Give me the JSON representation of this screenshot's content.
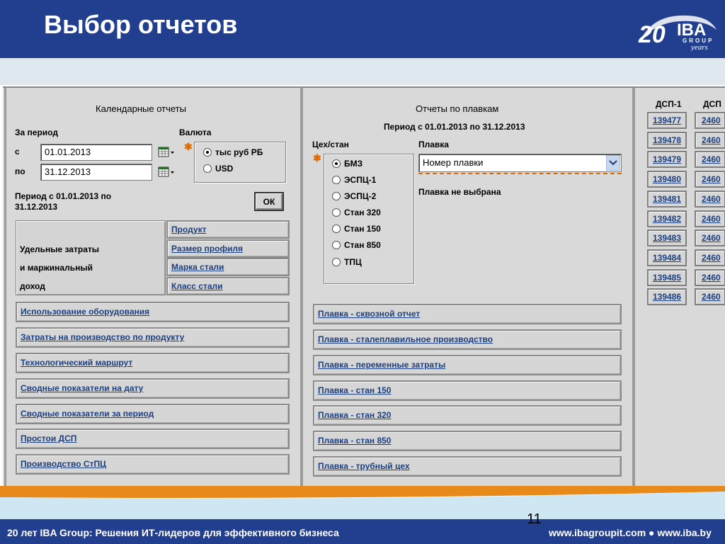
{
  "slide": {
    "title": "Выбор отчетов",
    "page_number": "11",
    "footer_left": "20 лет IBA Group: Решения ИТ-лидеров для эффективного бизнеса",
    "footer_right": "www.ibagroupit.com ● www.iba.by"
  },
  "logo": {
    "main": "IBA",
    "group": "GROUP",
    "years": "years",
    "number": "20"
  },
  "calendar": {
    "header": "Календарные отчеты",
    "period_label": "За период",
    "from_label": "с",
    "to_label": "по",
    "from_value": "01.01.2013",
    "to_value": "31.12.2013",
    "currency_label": "Валюта",
    "currency_options": [
      {
        "label": "тыс руб РБ",
        "selected": true
      },
      {
        "label": "USD",
        "selected": false
      }
    ],
    "period_text": "Период с 01.01.2013 по 31.12.2013",
    "period_text_line1": "Период с 01.01.2013 по",
    "period_text_line2": "31.12.2013",
    "ok_label": "ОК",
    "group_label_lines": [
      "Удельные затраты",
      "и маржинальный",
      "доход"
    ],
    "group_links": [
      "Продукт",
      "Размер профиля",
      "Марка стали",
      "Класс стали"
    ],
    "links": [
      "Использование оборудования",
      "Затраты на производство по продукту",
      "Технологический маршрут",
      "Сводные показатели на дату",
      "Сводные показатели за период",
      "Простои ДСП",
      "Производство СтПЦ"
    ]
  },
  "melts": {
    "header": "Отчеты по плавкам",
    "period_text": "Период с 01.01.2013 по 31.12.2013",
    "shop_label": "Цех/стан",
    "shops": [
      {
        "label": "БМЗ",
        "selected": true
      },
      {
        "label": "ЭСПЦ-1",
        "selected": false
      },
      {
        "label": "ЭСПЦ-2",
        "selected": false
      },
      {
        "label": "Стан 320",
        "selected": false
      },
      {
        "label": "Стан 150",
        "selected": false
      },
      {
        "label": "Стан 850",
        "selected": false
      },
      {
        "label": "ТПЦ",
        "selected": false
      }
    ],
    "melt_label": "Плавка",
    "melt_select_value": "Номер плавки",
    "melt_status": "Плавка не выбрана",
    "links": [
      "Плавка - сквозной отчет",
      "Плавка - сталеплавильное производство",
      "Плавка - переменные затраты",
      "Плавка - стан 150",
      "Плавка - стан 320",
      "Плавка - стан 850",
      "Плавка - трубный цех"
    ]
  },
  "dsp": {
    "col1_header": "ДСП-1",
    "col2_header": "ДСП",
    "col1_values": [
      "139477",
      "139478",
      "139479",
      "139480",
      "139481",
      "139482",
      "139483",
      "139484",
      "139485",
      "139486"
    ],
    "col2_values": [
      "2460",
      "2460",
      "2460",
      "2460",
      "2460",
      "2460",
      "2460",
      "2460",
      "2460",
      "2460"
    ]
  },
  "colors": {
    "brand_blue": "#223f8f",
    "link_blue": "#1c3f7f",
    "required_star": "#e06a00"
  }
}
